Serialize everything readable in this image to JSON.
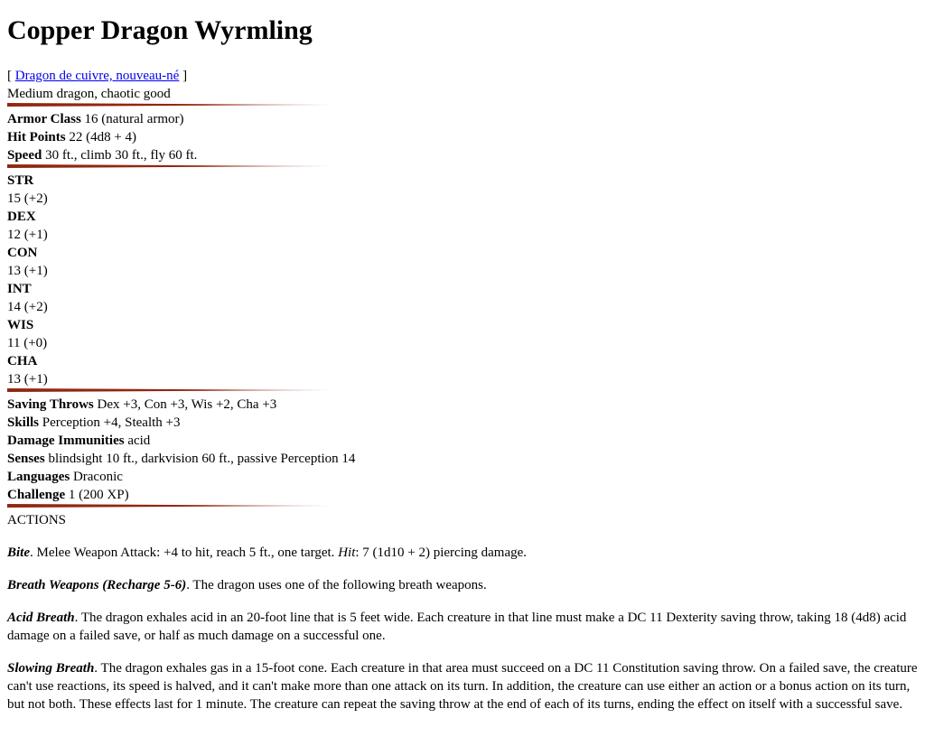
{
  "title": "Copper Dragon Wyrmling",
  "translation": {
    "open": "[ ",
    "link_text": "Dragon de cuivre, nouveau-né",
    "close": " ]"
  },
  "type_line": "Medium dragon, chaotic good",
  "defense": {
    "ac_label": "Armor Class",
    "ac_value": " 16 (natural armor)",
    "hp_label": "Hit Points",
    "hp_value": " 22 (4d8 + 4)",
    "speed_label": "Speed",
    "speed_value": " 30 ft., climb 30 ft., fly 60 ft."
  },
  "abilities": [
    {
      "name": "STR",
      "value": "15 (+2)"
    },
    {
      "name": "DEX",
      "value": "12 (+1)"
    },
    {
      "name": "CON",
      "value": "13 (+1)"
    },
    {
      "name": "INT",
      "value": "14 (+2)"
    },
    {
      "name": "WIS",
      "value": "11 (+0)"
    },
    {
      "name": "CHA",
      "value": "13 (+1)"
    }
  ],
  "properties": {
    "saves_label": "Saving Throws",
    "saves_value": " Dex +3, Con +3, Wis +2, Cha +3",
    "skills_label": "Skills",
    "skills_value": " Perception +4, Stealth +3",
    "immunities_label": "Damage Immunities",
    "immunities_value": " acid",
    "senses_label": "Senses",
    "senses_value": " blindsight 10 ft., darkvision 60 ft., passive Perception 14",
    "languages_label": "Languages",
    "languages_value": " Draconic",
    "challenge_label": "Challenge",
    "challenge_value": " 1 (200 XP)"
  },
  "actions_heading": "ACTIONS",
  "actions": {
    "bite_name": "Bite",
    "bite_text_1": ". Melee Weapon Attack: +4 to hit, reach 5 ft., one target. ",
    "bite_hit": "Hit",
    "bite_text_2": ": 7 (1d10 + 2) piercing damage.",
    "breath_name": "Breath Weapons (Recharge 5-6)",
    "breath_text": ". The dragon uses one of the following breath weapons.",
    "acid_name": "Acid Breath",
    "acid_text": ". The dragon exhales acid in an 20-foot line that is 5 feet wide. Each creature in that line must make a DC 11 Dexterity saving throw, taking 18 (4d8) acid damage on a failed save, or half as much damage on a successful one.",
    "slow_name": "Slowing Breath",
    "slow_text": ". The dragon exhales gas in a 15-foot cone. Each creature in that area must succeed on a DC 11 Constitution saving throw. On a failed save, the creature can't use reactions, its speed is halved, and it can't make more than one attack on its turn. In addition, the creature can use either an action or a bonus action on its turn, but not both. These effects last for 1 minute. The creature can repeat the saving throw at the end of each of its turns, ending the effect on itself with a successful save."
  },
  "colors": {
    "rule": "#922610",
    "link": "#0000ee"
  }
}
